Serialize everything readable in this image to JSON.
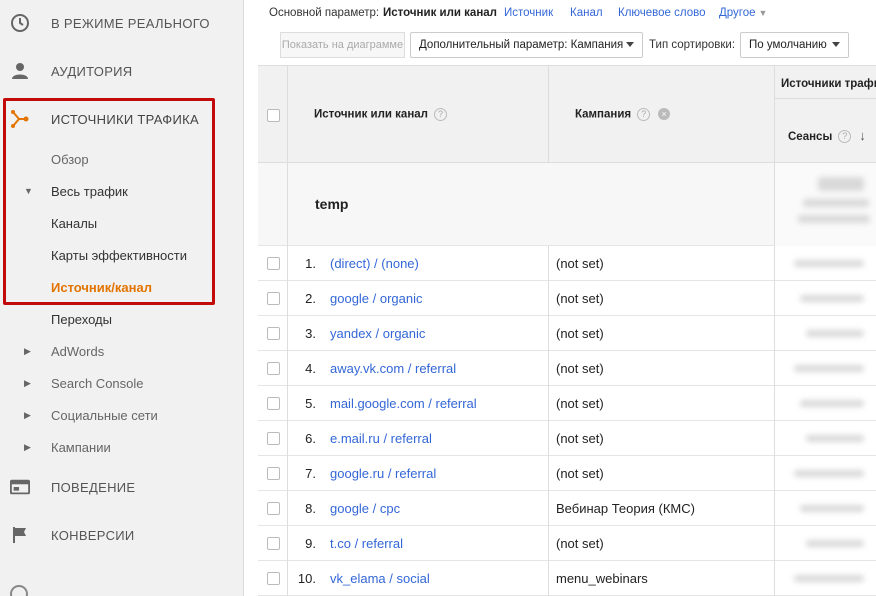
{
  "sidebar": {
    "sections": [
      {
        "label": "В РЕЖИМЕ РЕАЛЬНОГО",
        "icon": "clock-icon"
      },
      {
        "label": "АУДИТОРИЯ",
        "icon": "person-icon"
      },
      {
        "label": "ИСТОЧНИКИ ТРАФИКА",
        "icon": "acquisition-icon"
      },
      {
        "label": "ПОВЕДЕНИЕ",
        "icon": "behavior-icon"
      },
      {
        "label": "КОНВЕРСИИ",
        "icon": "flag-icon"
      }
    ],
    "sub_items": [
      {
        "label": "Обзор"
      },
      {
        "label": "Весь трафик"
      },
      {
        "label": "Каналы"
      },
      {
        "label": "Карты эффективности"
      },
      {
        "label": "Источник/канал"
      },
      {
        "label": "Переходы"
      },
      {
        "label": "AdWords"
      },
      {
        "label": "Search Console"
      },
      {
        "label": "Социальные сети"
      },
      {
        "label": "Кампании"
      }
    ]
  },
  "topbar": {
    "primary_label": "Основной параметр:",
    "current": "Источник или канал",
    "links": [
      "Источник",
      "Канал",
      "Ключевое слово"
    ],
    "other": "Другое"
  },
  "controls": {
    "show_chart": "Показать на диаграмме",
    "secondary_dim": "Дополнительный параметр: Кампания",
    "sort_label": "Тип сортировки:",
    "sort_value": "По умолчанию"
  },
  "table": {
    "col_source": "Источник или канал",
    "col_campaign": "Кампания",
    "col_traffic": "Источники трафик",
    "col_sessions": "Сеансы",
    "summary_label": "temp",
    "rows": [
      {
        "num": "1.",
        "source": "(direct) / (none)",
        "campaign": "(not set)"
      },
      {
        "num": "2.",
        "source": "google / organic",
        "campaign": "(not set)"
      },
      {
        "num": "3.",
        "source": "yandex / organic",
        "campaign": "(not set)"
      },
      {
        "num": "4.",
        "source": "away.vk.com / referral",
        "campaign": "(not set)"
      },
      {
        "num": "5.",
        "source": "mail.google.com / referral",
        "campaign": "(not set)"
      },
      {
        "num": "6.",
        "source": "e.mail.ru / referral",
        "campaign": "(not set)"
      },
      {
        "num": "7.",
        "source": "google.ru / referral",
        "campaign": "(not set)"
      },
      {
        "num": "8.",
        "source": "google / cpc",
        "campaign": "Вебинар Теория (КМС)"
      },
      {
        "num": "9.",
        "source": "t.co / referral",
        "campaign": "(not set)"
      },
      {
        "num": "10.",
        "source": "vk_elama / social",
        "campaign": "menu_webinars"
      }
    ]
  },
  "colors": {
    "accent_orange": "#e37400",
    "link_blue": "#3367d6",
    "highlight_red": "#c30a0a"
  }
}
